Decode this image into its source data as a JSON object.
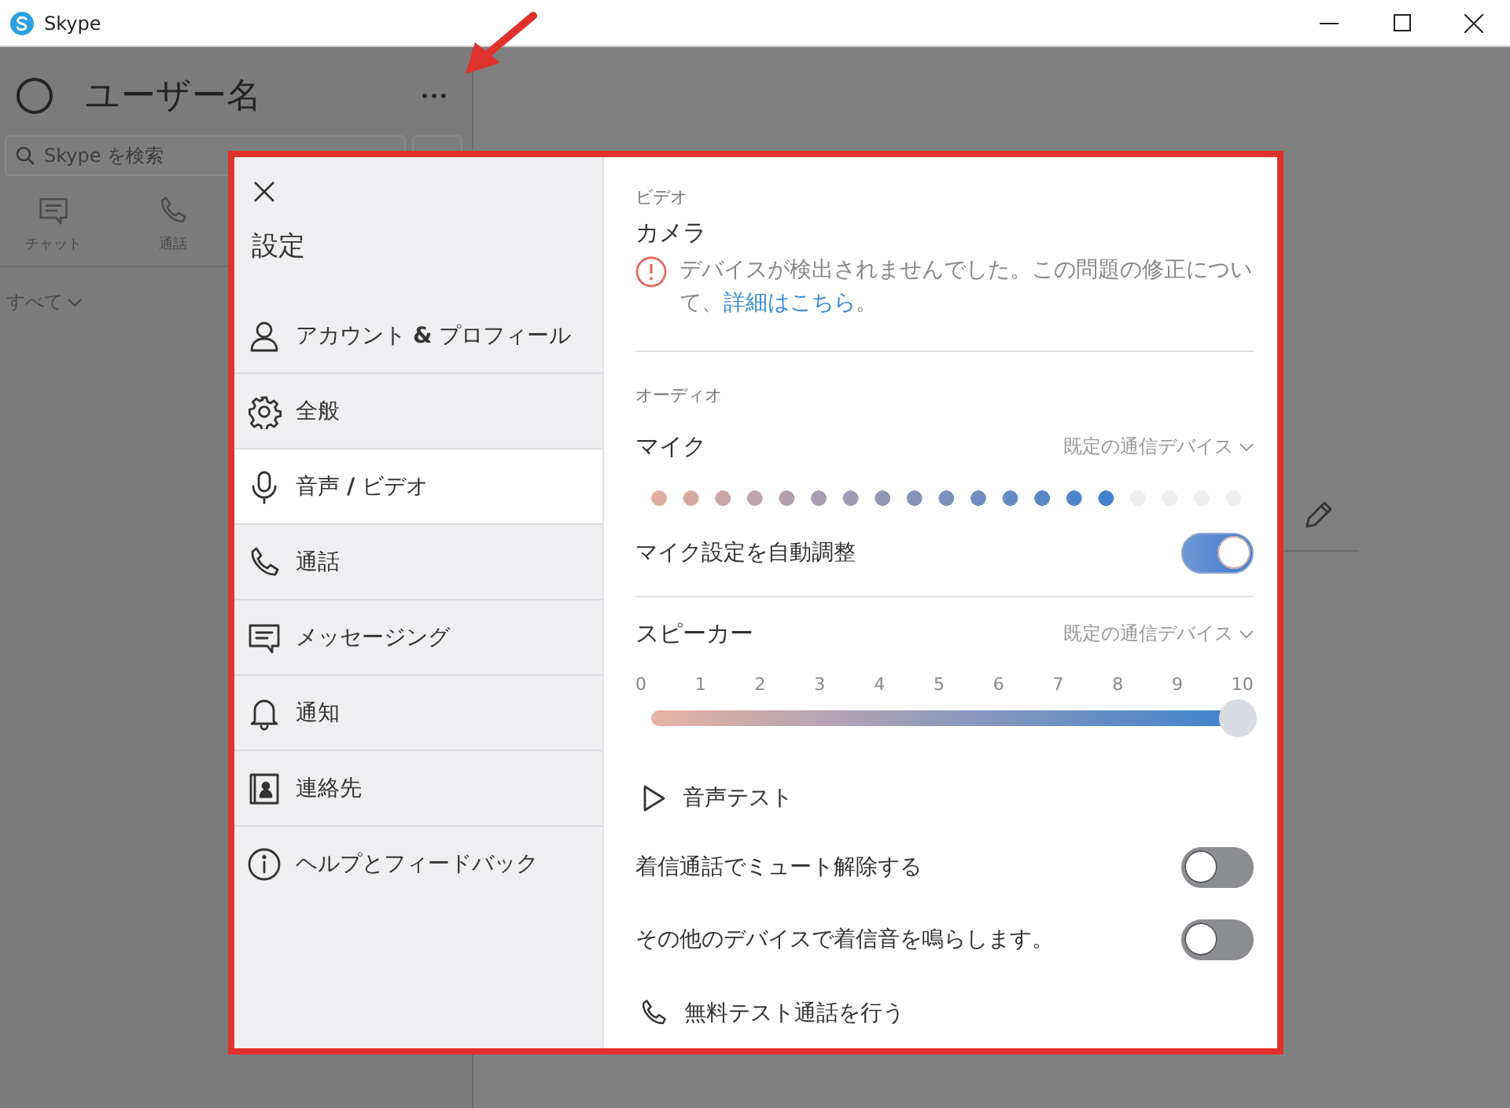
{
  "window": {
    "title": "Skype"
  },
  "sidebar": {
    "user_name": "ユーザー名",
    "search": {
      "placeholder": "Skype を検索"
    },
    "nav": [
      {
        "label": "チャット"
      },
      {
        "label": "通話"
      }
    ],
    "filter": "すべて"
  },
  "settings": {
    "title": "設定",
    "menu": [
      {
        "label": "アカウント **&** プロフィール",
        "selected": false
      },
      {
        "label": "全般",
        "selected": false
      },
      {
        "label": "音声 **/** ビデオ",
        "selected": true
      },
      {
        "label": "通話",
        "selected": false
      },
      {
        "label": "メッセージング",
        "selected": false
      },
      {
        "label": "通知",
        "selected": false
      },
      {
        "label": "連絡先",
        "selected": false
      },
      {
        "label": "ヘルプとフィードバック",
        "selected": false
      }
    ],
    "video": {
      "heading": "ビデオ",
      "camera_label": "カメラ",
      "error_text": "デバイスが検出されませんでした。この問題の修正について、",
      "error_link": "詳細はこちら",
      "error_end": "。"
    },
    "audio": {
      "heading": "オーディオ",
      "mic": {
        "label": "マイク",
        "device": "既定の通信デバイス",
        "level": 0.79
      },
      "auto_adjust": {
        "label": "マイク設定を自動調整",
        "on": true
      },
      "speaker": {
        "label": "スピーカー",
        "device": "既定の通信デバイス",
        "ticks": [
          "0",
          "1",
          "2",
          "3",
          "4",
          "5",
          "6",
          "7",
          "8",
          "9",
          "10"
        ],
        "level": 1
      },
      "sound_test": "音声テスト",
      "toggles": [
        {
          "label": "着信通話でミュート解除する",
          "on": false
        },
        {
          "label": "その他のデバイスで着信音を鳴らします。",
          "on": false
        }
      ],
      "test_call": "無料テスト通話を行う"
    }
  }
}
